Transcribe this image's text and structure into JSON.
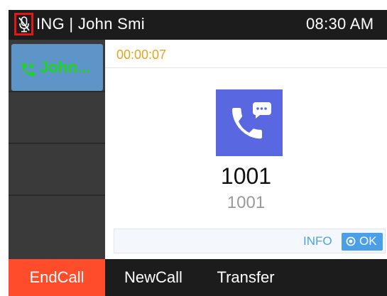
{
  "status_bar": {
    "title": "ING | John Smi",
    "time": "08:30 AM",
    "mute_icon": "microphone-muted-icon",
    "highlight_color": "#e01818"
  },
  "lines": {
    "active": {
      "label": "John...",
      "icon": "phone-incoming-icon",
      "color": "#1cd61c",
      "background": "#5e95c8"
    }
  },
  "call": {
    "duration": "00:00:07",
    "name": "1001",
    "number": "1001",
    "avatar_icon": "phone-chat-icon",
    "avatar_color": "#5967e0"
  },
  "info_bar": {
    "info_label": "INFO",
    "ok_label": "OK",
    "ok_icon": "circle-dot-icon"
  },
  "softkeys": {
    "end_call": "EndCall",
    "new_call": "NewCall",
    "transfer": "Transfer",
    "end_call_color": "#ff4c2a"
  }
}
